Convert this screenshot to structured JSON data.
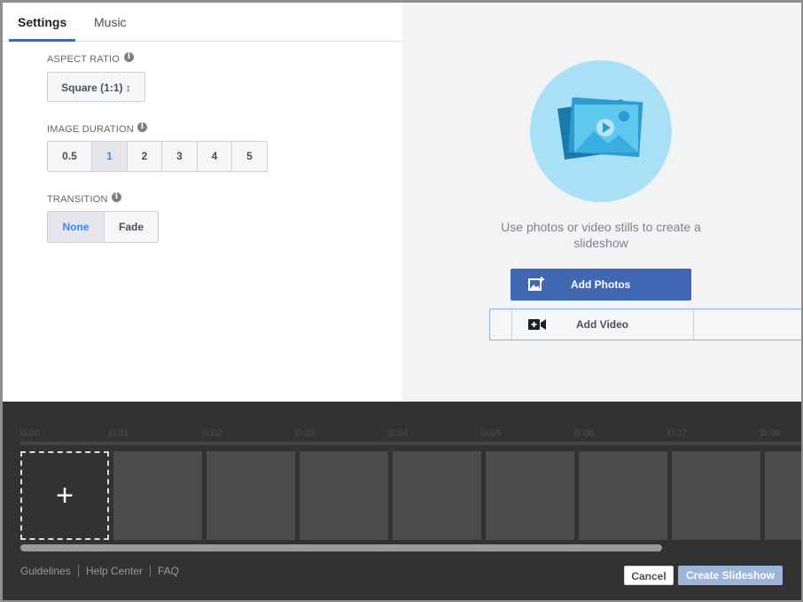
{
  "tabs": [
    {
      "label": "Settings",
      "active": true
    },
    {
      "label": "Music",
      "active": false
    }
  ],
  "settings": {
    "aspect_ratio_label": "ASPECT RATIO",
    "aspect_ratio_value": "Square (1:1) ↕",
    "image_duration_label": "IMAGE DURATION",
    "image_duration_options": [
      "0.5",
      "1",
      "2",
      "3",
      "4",
      "5"
    ],
    "image_duration_selected": "1",
    "transition_label": "TRANSITION",
    "transition_options": [
      "None",
      "Fade"
    ],
    "transition_selected": "None",
    "info_glyph": "i"
  },
  "media": {
    "hint": "Use photos or video stills to create a slideshow",
    "add_photos_label": "Add Photos",
    "add_video_label": "Add Video"
  },
  "timeline": {
    "ticks": [
      "0:00",
      "0:01",
      "0:02",
      "0:03",
      "0:04",
      "0:05",
      "0:06",
      "0:07",
      "0:08"
    ],
    "add_glyph": "+"
  },
  "footer": {
    "links": [
      "Guidelines",
      "Help Center",
      "FAQ"
    ],
    "cancel_label": "Cancel",
    "create_label": "Create Slideshow"
  },
  "colors": {
    "accent": "#4267b2",
    "selected_text": "#4080ff",
    "timeline_bg": "#323232",
    "hero_circle": "#a8e1f6"
  }
}
